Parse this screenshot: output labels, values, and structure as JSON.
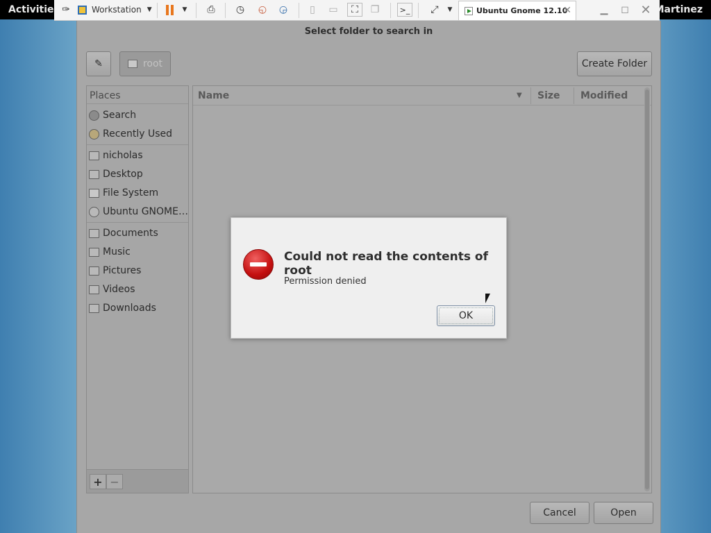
{
  "topbar": {
    "activities": "Activities",
    "user": "Martinez"
  },
  "vmware": {
    "workstation_label": "Workstation",
    "vm_tab": "Ubuntu Gnome 12.10"
  },
  "dialog": {
    "title": "Select folder to search in",
    "path_button": "root",
    "create_folder": "Create Folder",
    "places_header": "Places",
    "places": [
      {
        "label": "Search",
        "icon": "search-icon"
      },
      {
        "label": "Recently Used",
        "icon": "clock-icon"
      },
      {
        "label": "nicholas",
        "icon": "home-folder-icon"
      },
      {
        "label": "Desktop",
        "icon": "folder-icon"
      },
      {
        "label": "File System",
        "icon": "drive-icon"
      },
      {
        "label": "Ubuntu GNOME…",
        "icon": "disc-icon"
      },
      {
        "label": "Documents",
        "icon": "folder-icon"
      },
      {
        "label": "Music",
        "icon": "folder-icon"
      },
      {
        "label": "Pictures",
        "icon": "folder-icon"
      },
      {
        "label": "Videos",
        "icon": "folder-icon"
      },
      {
        "label": "Downloads",
        "icon": "folder-icon"
      }
    ],
    "add_label": "+",
    "remove_label": "−",
    "columns": {
      "name": "Name",
      "size": "Size",
      "modified": "Modified"
    },
    "cancel": "Cancel",
    "open": "Open"
  },
  "error": {
    "title": "Could not read the contents of root",
    "message": "Permission denied",
    "ok": "OK",
    "icon": "error-icon"
  }
}
